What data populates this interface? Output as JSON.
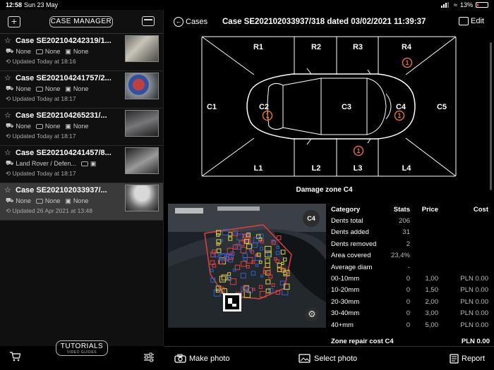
{
  "status_bar": {
    "time": "12:58",
    "date": "Sun 23 May",
    "battery": "13%"
  },
  "left_panel": {
    "case_manager_label": "CASE MANAGER",
    "cases": [
      {
        "title": "Case SE202104242319/1...",
        "field1": "None",
        "field2": "None",
        "field3": "None",
        "updated": "Updated Today at 18:16"
      },
      {
        "title": "Case SE202104241757/2...",
        "field1": "None",
        "field2": "None",
        "field3": "None",
        "updated": "Updated Today at 18:17"
      },
      {
        "title": "Case SE202104265231/...",
        "field1": "None",
        "field2": "None",
        "field3": "None",
        "updated": "Updated Today at 18:17"
      },
      {
        "title": "Case SE202104241457/8...",
        "field1": "Land Rover / Defen...",
        "updated": "Updated Today at 18:17"
      },
      {
        "title": "Case SE202102033937/...",
        "field1": "None",
        "field2": "None",
        "field3": "None",
        "updated": "Updated 26 Apr 2021 at 13:48"
      }
    ],
    "tutorials_label": "TUTORIALS",
    "tutorials_sub": "VIDEO GUIDES"
  },
  "header": {
    "back_label": "Cases",
    "title": "Case SE202102033937/318 dated 03/02/2021 11:39:37",
    "edit_label": "Edit"
  },
  "diagram": {
    "zones_top": [
      "R1",
      "R2",
      "R3",
      "R4"
    ],
    "zones_mid": [
      "C1",
      "C2",
      "C3",
      "C4",
      "C5"
    ],
    "zones_bottom": [
      "L1",
      "L2",
      "L3",
      "L4"
    ],
    "markers": [
      {
        "zone": "R4",
        "count": "1"
      },
      {
        "zone": "C2",
        "count": "1"
      },
      {
        "zone": "C4",
        "count": "1"
      },
      {
        "zone": "L3",
        "count": "1"
      }
    ],
    "marker_color": "#e07030"
  },
  "zone_title": "Damage zone C4",
  "photo_badge": "C4",
  "table": {
    "headers": [
      "Category",
      "Stats",
      "Price",
      "Cost"
    ],
    "rows": [
      [
        "Dents total",
        "206",
        "",
        ""
      ],
      [
        "Dents added",
        "31",
        "",
        ""
      ],
      [
        "Dents removed",
        "2",
        "",
        ""
      ],
      [
        "Area covered",
        "23,4%",
        "",
        ""
      ],
      [
        "Average diam",
        "-",
        "",
        ""
      ],
      [
        "00-10mm",
        "0",
        "1,00",
        "PLN 0.00"
      ],
      [
        "10-20mm",
        "0",
        "1,50",
        "PLN 0.00"
      ],
      [
        "20-30mm",
        "0",
        "2,00",
        "PLN 0.00"
      ],
      [
        "30-40mm",
        "0",
        "3,00",
        "PLN 0.00"
      ],
      [
        "40+mm",
        "0",
        "5,00",
        "PLN 0.00"
      ]
    ],
    "zone_repair_label": "Zone repair cost C4",
    "zone_repair_value": "PLN 0.00"
  },
  "bottom_bar": {
    "make_photo": "Make photo",
    "select_photo": "Select photo",
    "report": "Report"
  }
}
